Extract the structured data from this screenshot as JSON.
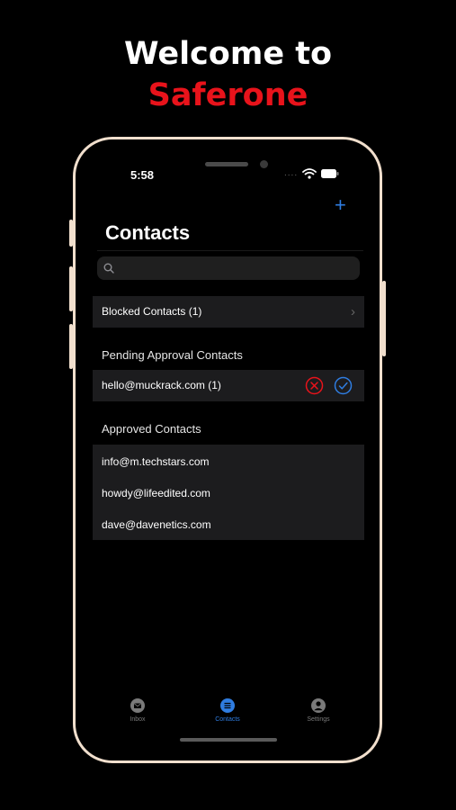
{
  "promo": {
    "line1": "Welcome to",
    "line2": "Saferone",
    "line1_color": "#ffffff",
    "line2_color": "#e8131b"
  },
  "status_bar": {
    "time": "5:58",
    "signal_dots": "...."
  },
  "header": {
    "title": "Contacts",
    "add_icon": "plus-icon"
  },
  "search": {
    "placeholder": ""
  },
  "blocked": {
    "label": "Blocked Contacts (1)",
    "chevron": "›"
  },
  "pending": {
    "section_title": "Pending Approval Contacts",
    "items": [
      {
        "email": "hello@muckrack.com (1)"
      }
    ],
    "reject_color": "#e8131b",
    "approve_color": "#2f7de1"
  },
  "approved": {
    "section_title": "Approved Contacts",
    "items": [
      {
        "email": "info@m.techstars.com"
      },
      {
        "email": "howdy@lifeedited.com"
      },
      {
        "email": "dave@davenetics.com"
      }
    ]
  },
  "tabs": [
    {
      "label": "Inbox",
      "icon": "mail-icon",
      "active": false
    },
    {
      "label": "Contacts",
      "icon": "list-icon",
      "active": true
    },
    {
      "label": "Settings",
      "icon": "person-icon",
      "active": false
    }
  ],
  "colors": {
    "accent": "#2f7de1",
    "background": "#000000",
    "cell": "#1c1c1e",
    "phone_frame": "#f1dfcd"
  }
}
